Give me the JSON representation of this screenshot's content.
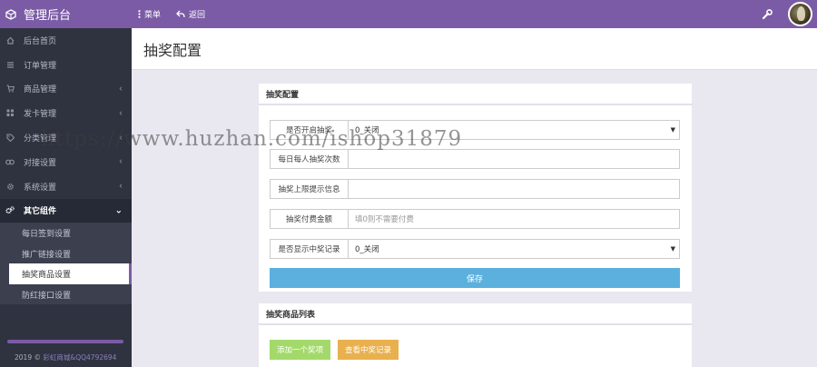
{
  "header": {
    "brand_title": "管理后台",
    "menu_label": "菜单",
    "back_label": "返回"
  },
  "sidebar": {
    "items": [
      {
        "label": "后台首页",
        "icon": "home-icon",
        "has_chevron": false
      },
      {
        "label": "订单管理",
        "icon": "list-icon",
        "has_chevron": false
      },
      {
        "label": "商品管理",
        "icon": "cart-icon",
        "has_chevron": true
      },
      {
        "label": "发卡管理",
        "icon": "grid-icon",
        "has_chevron": true
      },
      {
        "label": "分类管理",
        "icon": "tags-icon",
        "has_chevron": true
      },
      {
        "label": "对接设置",
        "icon": "link-icon",
        "has_chevron": true
      },
      {
        "label": "系统设置",
        "icon": "gear-icon",
        "has_chevron": true
      },
      {
        "label": "其它组件",
        "icon": "gears-icon",
        "has_chevron": true,
        "active": true
      }
    ],
    "submenu": [
      {
        "label": "每日签到设置"
      },
      {
        "label": "推广链接设置"
      },
      {
        "label": "抽奖商品设置",
        "selected": true
      },
      {
        "label": "防红接口设置"
      }
    ],
    "copyright_prefix": "2019 ©",
    "copyright_link": "彩虹商城&QQ4792694"
  },
  "page": {
    "title": "抽奖配置"
  },
  "config_panel": {
    "title": "抽奖配置",
    "fields": [
      {
        "label": "是否开启抽奖",
        "type": "select",
        "value": "0_关闭"
      },
      {
        "label": "每日每人抽奖次数",
        "type": "input",
        "value": "",
        "placeholder": ""
      },
      {
        "label": "抽奖上限提示信息",
        "type": "input",
        "value": "",
        "placeholder": ""
      },
      {
        "label": "抽奖付费金额",
        "type": "input",
        "value": "",
        "placeholder": "填0则不需要付费"
      },
      {
        "label": "是否显示中奖记录",
        "type": "select",
        "value": "0_关闭"
      }
    ],
    "save_label": "保存"
  },
  "list_panel": {
    "title": "抽奖商品列表",
    "add_label": "添加一个奖项",
    "view_label": "查看中奖记录"
  },
  "watermark": "https://www.huzhan.com/ishop31879",
  "colors": {
    "topbar": "#7b5ba6",
    "sidebar": "#2f3340",
    "save_button": "#5bb0de",
    "add_button": "#a3d96a",
    "view_button": "#e9b04e"
  }
}
